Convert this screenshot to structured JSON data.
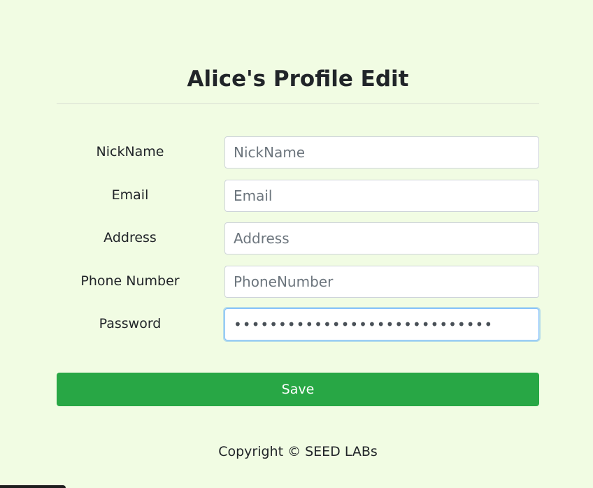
{
  "page": {
    "title": "Alice's Profile Edit",
    "footer": "Copyright © SEED LABs"
  },
  "form": {
    "fields": [
      {
        "label": "NickName",
        "placeholder": "NickName",
        "value": ""
      },
      {
        "label": "Email",
        "placeholder": "Email",
        "value": ""
      },
      {
        "label": "Address",
        "placeholder": "Address",
        "value": ""
      },
      {
        "label": "Phone Number",
        "placeholder": "PhoneNumber",
        "value": ""
      },
      {
        "label": "Password",
        "placeholder": "",
        "value": "•••••••••••••••••••••••••••••",
        "focused": true
      }
    ],
    "save_label": "Save"
  },
  "colors": {
    "background": "#f1fce3",
    "save_button": "#28a745",
    "text": "#212529"
  }
}
